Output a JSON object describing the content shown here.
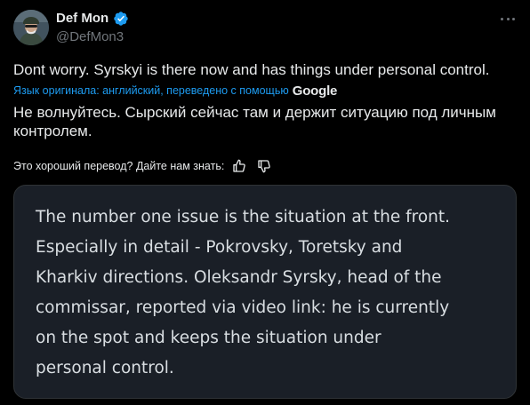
{
  "author": {
    "name": "Def Mon",
    "handle": "@DefMon3",
    "avatar_icon": "avatar-photo",
    "verified_icon": "verified-badge-icon",
    "verified_color": "#1d9bf0"
  },
  "menu_icon": "more-icon",
  "tweet": {
    "text": "Dont worry. Syrskyi is there now and has things under personal control."
  },
  "translation": {
    "notice": "Язык оригинала: английский, переведено с помощью",
    "provider": "Google",
    "text": "Не волнуйтесь. Сырский сейчас там и держит ситуацию под личным контролем."
  },
  "feedback": {
    "prompt": "Это хороший перевод? Дайте нам знать:",
    "like_icon": "thumbs-up-icon",
    "dislike_icon": "thumbs-down-icon"
  },
  "quote_image": {
    "lines": [
      "The number one issue is the situation at the front.",
      "Especially in detail - Pokrovsky, Toretsky and",
      "Kharkiv directions. Oleksandr Syrsky, head of the",
      "commissar, reported via video link: he is currently",
      "on the spot and keeps the situation under",
      "personal control."
    ]
  },
  "colors": {
    "background": "#000000",
    "text": "#e7e9ea",
    "muted": "#71767b",
    "link": "#1d9bf0",
    "card_bg": "#1a1f27"
  }
}
